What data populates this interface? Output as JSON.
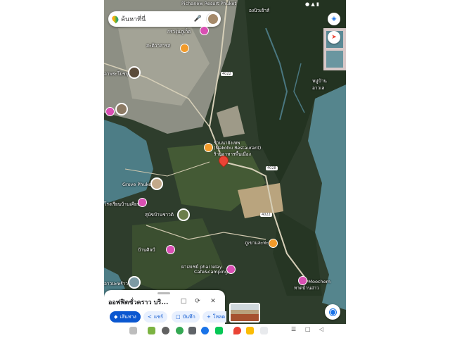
{
  "status_bar": {
    "time": "",
    "icons": "● ▲ ▮"
  },
  "search": {
    "placeholder": "ค้นหาที่นี่"
  },
  "map": {
    "labels": {
      "resort": "Pichanew Resort Phuket",
      "l1": "องนิวเฮ้าส์",
      "l2": "กรวงุ่นภูเก็ต",
      "l3": "สะติวาสารส",
      "l4": "อาพระโยชบุคดี",
      "village": "หมู่บ้าน\nอาวเล",
      "restaurant1": "ร้านนายังเทพ",
      "restaurant2": "(Nakobu Restaurant)",
      "restaurant3": "ร้านอาหารพื้นเมือง",
      "grove": "Grove Phuket",
      "l5": "โรงเรียนบ้านเคียน",
      "l6": "สุนัขบ้านชาวดิ",
      "l7": "บ้านศิลป์",
      "l8": "ภูเขาและทะเล",
      "l9": "ผาเลเชย์ phai lelay",
      "l10": "Cafe&camping",
      "l11": "อาวมะพร้าว",
      "moochem": "Ao Moochem",
      "l12": "หาดบ้านอ่าว"
    },
    "roads": {
      "r1": "4022",
      "r2": "4022",
      "r3": "4028"
    }
  },
  "place_sheet": {
    "title": "ออฟฟิตชั่วคราว บริ...",
    "chips": {
      "directions": "เส้นทาง",
      "share": "แชร์",
      "save": "บันทึก",
      "more": "โหลด"
    }
  },
  "colors": {
    "accent": "#0b57d0",
    "pin": "#ea4335",
    "sea": "#4d7d86",
    "land": "#2d3f2a"
  },
  "taskbar_icons": [
    "grid-icon",
    "game-icon",
    "camera-icon",
    "chrome-icon",
    "settings-icon",
    "browser-icon",
    "line-icon",
    "maps-icon",
    "drive-icon",
    "photos-icon"
  ]
}
